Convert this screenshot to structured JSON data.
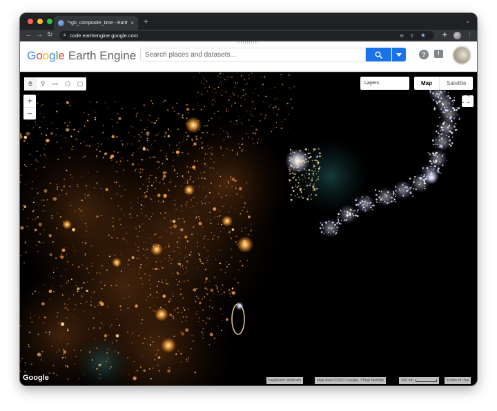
{
  "browser": {
    "tab_title": "*rgb_composite_time - Earth E",
    "tab_close": "×",
    "new_tab": "+",
    "url": "code.earthengine.google.com"
  },
  "header": {
    "logo_google": "Google",
    "logo_product": "Earth Engine",
    "search_placeholder": "Search places and datasets...",
    "help_glyph": "?",
    "feedback_glyph": "!"
  },
  "map": {
    "zoom_in": "+",
    "zoom_out": "−",
    "layers_label": "Layers",
    "map_type_options": [
      "Map",
      "Satellite"
    ],
    "selected_map_type": "Map",
    "watermark": "Google",
    "attribution": {
      "keyboard_shortcuts": "Keyboard shortcuts",
      "map_data": "Map data ©2022 Google, TMap Mobility",
      "scale": "200 km",
      "terms": "Terms of Use"
    }
  },
  "colors": {
    "search_button": "#1a73e8",
    "map_background": "#000000",
    "city_lights": "#ffb347"
  }
}
